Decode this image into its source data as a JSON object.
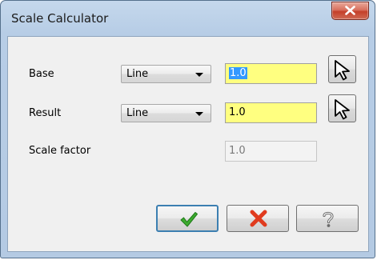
{
  "window": {
    "title": "Scale Calculator"
  },
  "base": {
    "label": "Base",
    "type_value": "Line",
    "value": "1.0"
  },
  "result": {
    "label": "Result",
    "type_value": "Line",
    "value": "1.0"
  },
  "scale": {
    "label": "Scale factor",
    "value": "1.0"
  },
  "icons": {
    "close": "close-icon",
    "pick": "pointer-arrow-icon",
    "ok": "checkmark-icon",
    "cancel": "red-x-icon",
    "help": "question-mark-icon"
  },
  "colors": {
    "field_highlight": "#ffff80",
    "selection": "#3399ff",
    "ok_check": "#3cab2f",
    "cancel_x": "#e03b1e"
  }
}
